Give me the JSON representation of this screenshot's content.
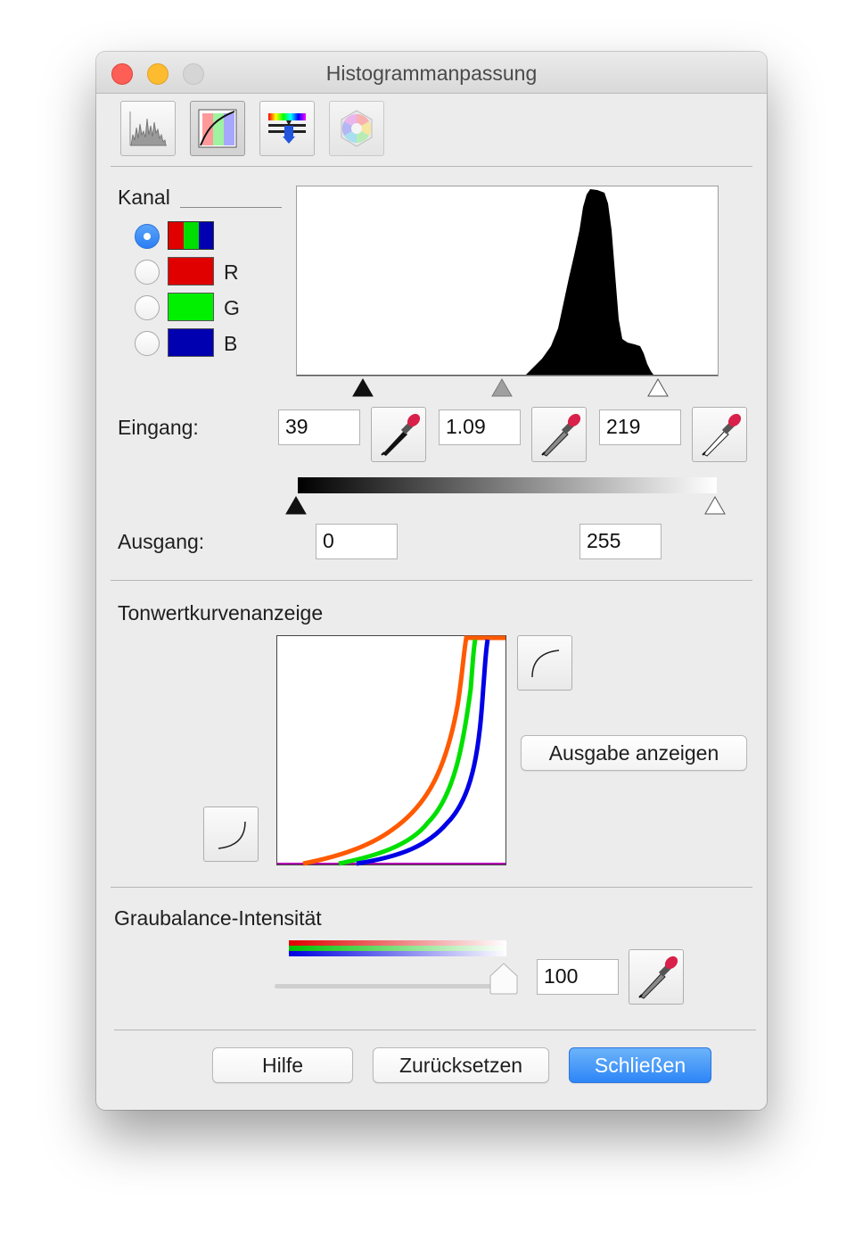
{
  "window": {
    "title": "Histogrammanpassung"
  },
  "toolbar": {
    "tools": [
      {
        "name": "histogram",
        "icon": "histogram-icon"
      },
      {
        "name": "tone-curve",
        "icon": "tone-curve-icon",
        "selected": true
      },
      {
        "name": "color-balance",
        "icon": "color-balance-icon"
      },
      {
        "name": "color-wheel",
        "icon": "color-wheel-icon"
      }
    ]
  },
  "channel": {
    "label": "Kanal",
    "options": [
      {
        "id": "rgb",
        "label": "",
        "selected": true,
        "colors": [
          "#e00000",
          "#00dd00",
          "#0000b0"
        ]
      },
      {
        "id": "r",
        "label": "R",
        "selected": false,
        "colors": [
          "#e00000"
        ]
      },
      {
        "id": "g",
        "label": "G",
        "selected": false,
        "colors": [
          "#00f000"
        ]
      },
      {
        "id": "b",
        "label": "B",
        "selected": false,
        "colors": [
          "#0000b0"
        ]
      }
    ]
  },
  "input": {
    "label": "Eingang:",
    "black": "39",
    "gamma": "1.09",
    "white": "219"
  },
  "output": {
    "label": "Ausgang:",
    "black": "0",
    "white": "255"
  },
  "tone_curve": {
    "label": "Tonwertkurvenanzeige",
    "show_output_button": "Ausgabe anzeigen"
  },
  "gray_balance": {
    "label": "Graubalance-Intensität",
    "value": "100",
    "slider_fraction": 1.0
  },
  "footer": {
    "help": "Hilfe",
    "reset": "Zurücksetzen",
    "close": "Schließen"
  },
  "colors": {
    "accent": "#2d86f7",
    "curve_red": "#ff5a00",
    "curve_green": "#00e000",
    "curve_blue": "#0000e6"
  }
}
